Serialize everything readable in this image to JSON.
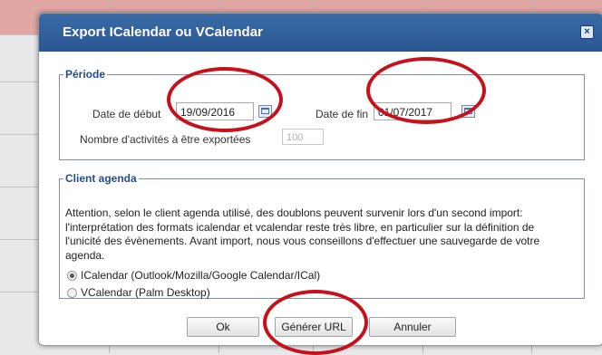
{
  "dialog": {
    "title": "Export ICalendar ou VCalendar",
    "close_symbol": "×"
  },
  "periode": {
    "legend": "Période",
    "start_label": "Date de début",
    "start_value": "19/09/2016",
    "end_label": "Date de fin",
    "end_value": "01/07/2017",
    "count_label": "Nombre d'activités à être exportées",
    "count_value": "100"
  },
  "client": {
    "legend": "Client agenda",
    "paragraph": "Attention, selon le client agenda utilisé, des doublons peuvent survenir lors d'un second import: l'interprétation des formats icalendar et vcalendar reste très libre, en particulier sur la définition de l'unicité des évènements. Avant import, nous vous conseillons d'effectuer une sauvegarde de votre agenda.",
    "options": [
      {
        "label": "ICalendar (Outlook/Mozilla/Google Calendar/ICal)",
        "checked": true
      },
      {
        "label": "VCalendar (Palm Desktop)",
        "checked": false
      }
    ]
  },
  "buttons": {
    "ok": "Ok",
    "generate": "Générer URL",
    "cancel": "Annuler"
  },
  "colors": {
    "titlebar": "#2f5f99",
    "legend": "#264d8a",
    "annotation": "#c8101a"
  }
}
